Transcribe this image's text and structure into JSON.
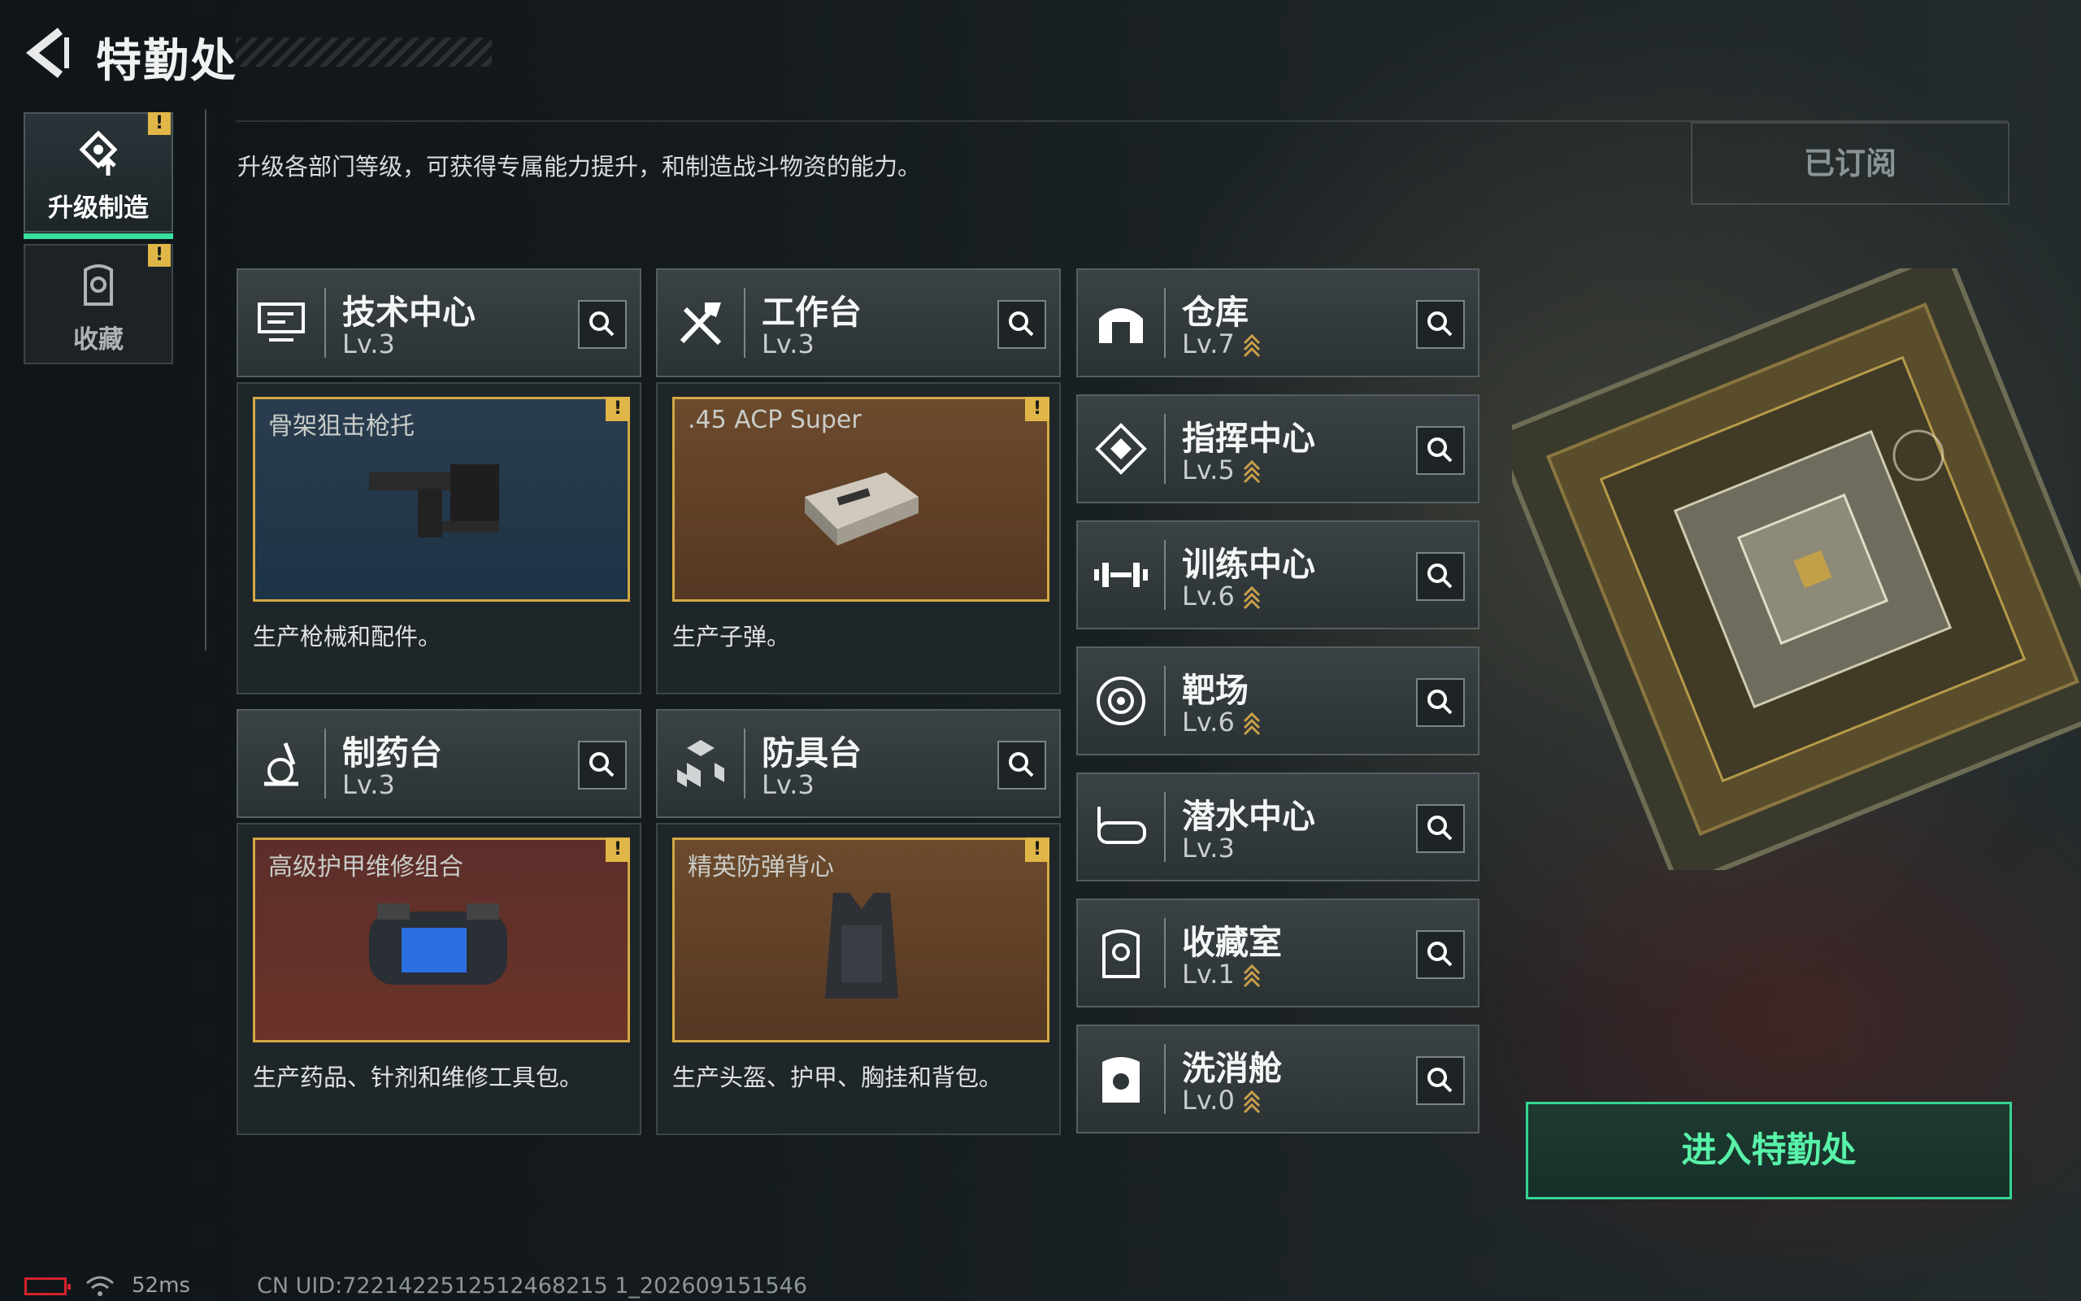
{
  "header": {
    "title": "特勤处"
  },
  "sidebar": {
    "items": [
      {
        "label": "升级制造",
        "active": true,
        "warning": "!"
      },
      {
        "label": "收藏",
        "active": false,
        "warning": "!"
      }
    ]
  },
  "description": "升级各部门等级，可获得专属能力提升，和制造战斗物资的能力。",
  "subscribed_label": "已订阅",
  "production_departments": [
    {
      "name": "技术中心",
      "level": "Lv.3",
      "icon": "tech-center-icon",
      "item": {
        "name": "骨架狙击枪托",
        "warning": "!",
        "desc": "生产枪械和配件。",
        "theme": "blue"
      }
    },
    {
      "name": "工作台",
      "level": "Lv.3",
      "icon": "workbench-icon",
      "item": {
        "name": ".45 ACP Super",
        "warning": "!",
        "desc": "生产子弹。",
        "theme": "brown"
      }
    },
    {
      "name": "制药台",
      "level": "Lv.3",
      "icon": "pharmacy-icon",
      "item": {
        "name": "高级护甲维修组合",
        "warning": "!",
        "desc": "生产药品、针剂和维修工具包。",
        "theme": "red"
      }
    },
    {
      "name": "防具台",
      "level": "Lv.3",
      "icon": "armor-bench-icon",
      "item": {
        "name": "精英防弹背心",
        "warning": "!",
        "desc": "生产头盔、护甲、胸挂和背包。",
        "theme": "brown"
      }
    }
  ],
  "facilities": [
    {
      "name": "仓库",
      "level": "Lv.7",
      "icon": "warehouse-icon",
      "upgradable": true
    },
    {
      "name": "指挥中心",
      "level": "Lv.5",
      "icon": "command-center-icon",
      "upgradable": true
    },
    {
      "name": "训练中心",
      "level": "Lv.6",
      "icon": "training-center-icon",
      "upgradable": true
    },
    {
      "name": "靶场",
      "level": "Lv.6",
      "icon": "shooting-range-icon",
      "upgradable": true
    },
    {
      "name": "潜水中心",
      "level": "Lv.3",
      "icon": "dive-center-icon",
      "upgradable": false
    },
    {
      "name": "收藏室",
      "level": "Lv.1",
      "icon": "collection-room-icon",
      "upgradable": true
    },
    {
      "name": "洗消舱",
      "level": "Lv.0",
      "icon": "decon-chamber-icon",
      "upgradable": true
    }
  ],
  "enter_button": "进入特勤处",
  "status": {
    "ping": "52ms",
    "uid": "CN UID:7221422512512468215 1_202609151546"
  },
  "colors": {
    "accent": "#37e0a0",
    "warning": "#e0b648",
    "upgrade_chevron": "#c9a04a",
    "card_border": "#d3a845"
  }
}
